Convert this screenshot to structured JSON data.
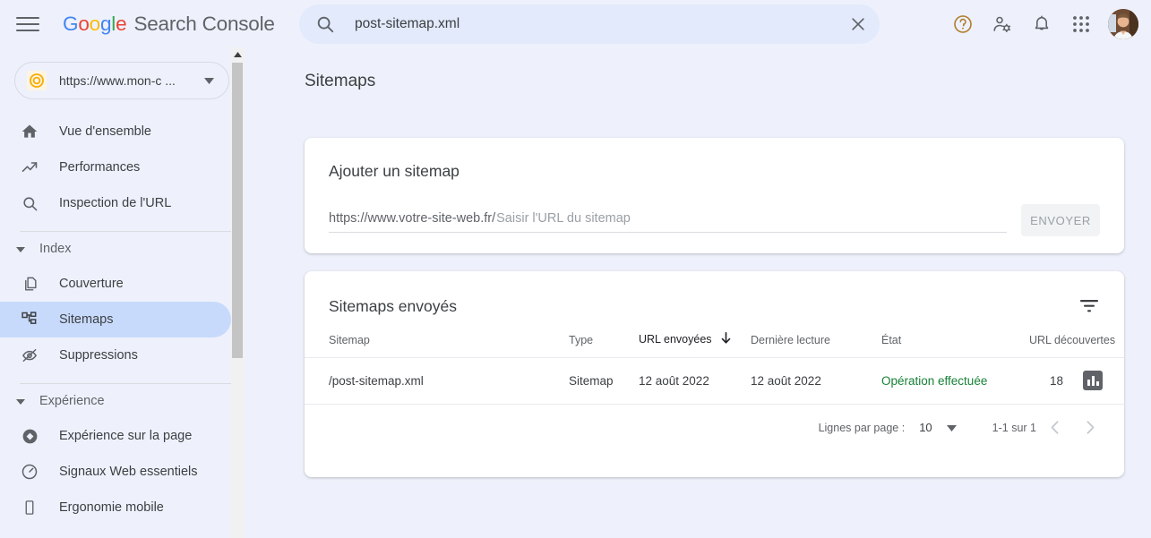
{
  "app": {
    "brand_google": "Google",
    "brand_product": "Search Console",
    "menu_icon": "hamburger-icon"
  },
  "search": {
    "value": "post-sitemap.xml",
    "placeholder": "",
    "icon": "search-icon",
    "clear_icon": "close-icon"
  },
  "topbar_icons": {
    "help": "help-icon",
    "account_settings": "account-settings-icon",
    "notifications": "notification-bell-icon",
    "apps": "apps-grid-icon",
    "avatar": "user-avatar"
  },
  "property": {
    "label": "https://www.mon-c  ...",
    "icon": "property-target-icon",
    "caret": "chevron-down-icon"
  },
  "sidebar": {
    "items": [
      {
        "label": "Vue d'ensemble",
        "icon": "home-icon",
        "active": false
      },
      {
        "label": "Performances",
        "icon": "trending-up-icon",
        "active": false
      },
      {
        "label": "Inspection de l'URL",
        "icon": "search-icon",
        "active": false
      }
    ],
    "groups": [
      {
        "label": "Index",
        "caret": "caret-down-icon",
        "items": [
          {
            "label": "Couverture",
            "icon": "pages-copy-icon",
            "active": false
          },
          {
            "label": "Sitemaps",
            "icon": "sitemap-tree-icon",
            "active": true
          },
          {
            "label": "Suppressions",
            "icon": "eye-off-icon",
            "active": false
          }
        ]
      },
      {
        "label": "Expérience",
        "caret": "caret-down-icon",
        "items": [
          {
            "label": "Expérience sur la page",
            "icon": "page-experience-icon",
            "active": false
          },
          {
            "label": "Signaux Web essentiels",
            "icon": "speedometer-icon",
            "active": false
          },
          {
            "label": "Ergonomie mobile",
            "icon": "mobile-phone-icon",
            "active": false
          }
        ]
      }
    ]
  },
  "main": {
    "page_title": "Sitemaps",
    "add_card": {
      "title": "Ajouter un sitemap",
      "url_prefix": "https://www.votre-site-web.fr/",
      "url_value": "",
      "url_placeholder": "Saisir l'URL du sitemap",
      "submit_label": "ENVOYER"
    },
    "table_card": {
      "title": "Sitemaps envoyés",
      "filter_icon": "filter-icon",
      "columns": [
        {
          "label": "Sitemap",
          "sorted": false
        },
        {
          "label": "Type",
          "sorted": false
        },
        {
          "label": "URL envoyées",
          "sorted": true,
          "sort_icon": "arrow-down-icon"
        },
        {
          "label": "Dernière lecture",
          "sorted": false
        },
        {
          "label": "État",
          "sorted": false
        },
        {
          "label": "URL découvertes",
          "sorted": false
        }
      ],
      "rows": [
        {
          "sitemap": "/post-sitemap.xml",
          "type": "Sitemap",
          "urls_sent": "12 août 2022",
          "last_read": "12 août 2022",
          "state": "Opération effectuée",
          "urls_found": "18",
          "chart_icon": "bar-chart-icon"
        }
      ],
      "pagination": {
        "rows_per_page_label": "Lignes par page :",
        "rows_per_page_value": "10",
        "dropdown_icon": "caret-down-icon",
        "range": "1-1 sur 1",
        "prev_icon": "chevron-left-icon",
        "next_icon": "chevron-right-icon"
      }
    }
  },
  "colors": {
    "page_background": "#eef1fb",
    "card_background": "#ffffff",
    "accent_blue": "#1a73e8",
    "active_nav": "#c8dafc",
    "status_green": "#188038",
    "text_primary": "#3c4043",
    "text_secondary": "#5f6368"
  }
}
